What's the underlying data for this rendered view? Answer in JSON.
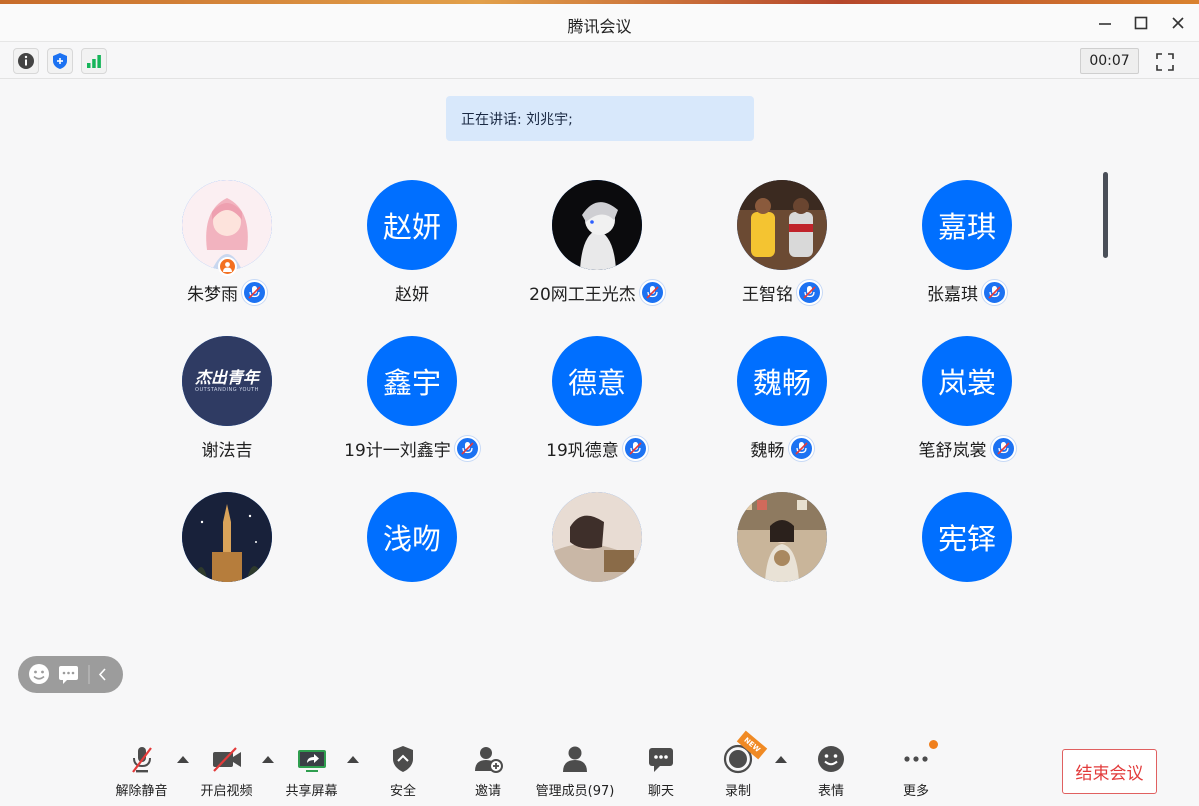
{
  "window": {
    "title": "腾讯会议"
  },
  "toolbar": {
    "timer": "00:07"
  },
  "speaking": {
    "text": "正在讲话: 刘兆宇;"
  },
  "participants": [
    {
      "name": "朱梦雨",
      "avatar_text": "",
      "avatar_kind": "anime-girl",
      "muted": true,
      "host": true
    },
    {
      "name": "赵妍",
      "avatar_text": "赵妍",
      "avatar_kind": "text",
      "muted": false,
      "host": false
    },
    {
      "name": "20网工王光杰",
      "avatar_text": "",
      "avatar_kind": "anime-boy",
      "muted": true,
      "host": false
    },
    {
      "name": "王智铭",
      "avatar_text": "",
      "avatar_kind": "basketball",
      "muted": true,
      "host": false
    },
    {
      "name": "张嘉琪",
      "avatar_text": "嘉琪",
      "avatar_kind": "text",
      "muted": true,
      "host": false
    },
    {
      "name": "谢法吉",
      "avatar_text": "杰出青年",
      "avatar_sub": "OUTSTANDING YOUTH",
      "avatar_kind": "logo",
      "muted": false,
      "host": false
    },
    {
      "name": "19计一刘鑫宇",
      "avatar_text": "鑫宇",
      "avatar_kind": "text",
      "muted": true,
      "host": false
    },
    {
      "name": "19巩德意",
      "avatar_text": "德意",
      "avatar_kind": "text",
      "muted": true,
      "host": false
    },
    {
      "name": "魏畅",
      "avatar_text": "魏畅",
      "avatar_kind": "text",
      "muted": true,
      "host": false
    },
    {
      "name": "笔舒岚裳",
      "avatar_text": "岚裳",
      "avatar_kind": "text",
      "muted": true,
      "host": false
    },
    {
      "name": "",
      "avatar_text": "",
      "avatar_kind": "night-tower",
      "muted": false,
      "host": false
    },
    {
      "name": "",
      "avatar_text": "浅吻",
      "avatar_kind": "text",
      "muted": false,
      "host": false
    },
    {
      "name": "",
      "avatar_text": "",
      "avatar_kind": "photo-girl",
      "muted": false,
      "host": false
    },
    {
      "name": "",
      "avatar_text": "",
      "avatar_kind": "photo-shop",
      "muted": false,
      "host": false
    },
    {
      "name": "",
      "avatar_text": "宪铎",
      "avatar_kind": "text",
      "muted": false,
      "host": false
    }
  ],
  "bottombar": {
    "unmute": "解除静音",
    "video": "开启视频",
    "share": "共享屏幕",
    "security": "安全",
    "invite": "邀请",
    "members": "管理成员(97)",
    "chat": "聊天",
    "record": "录制",
    "record_badge": "NEW",
    "reactions": "表情",
    "more": "更多",
    "end": "结束会议"
  },
  "colors": {
    "accent": "#006fff",
    "end": "#e23b3b",
    "badge": "#f08a24"
  }
}
